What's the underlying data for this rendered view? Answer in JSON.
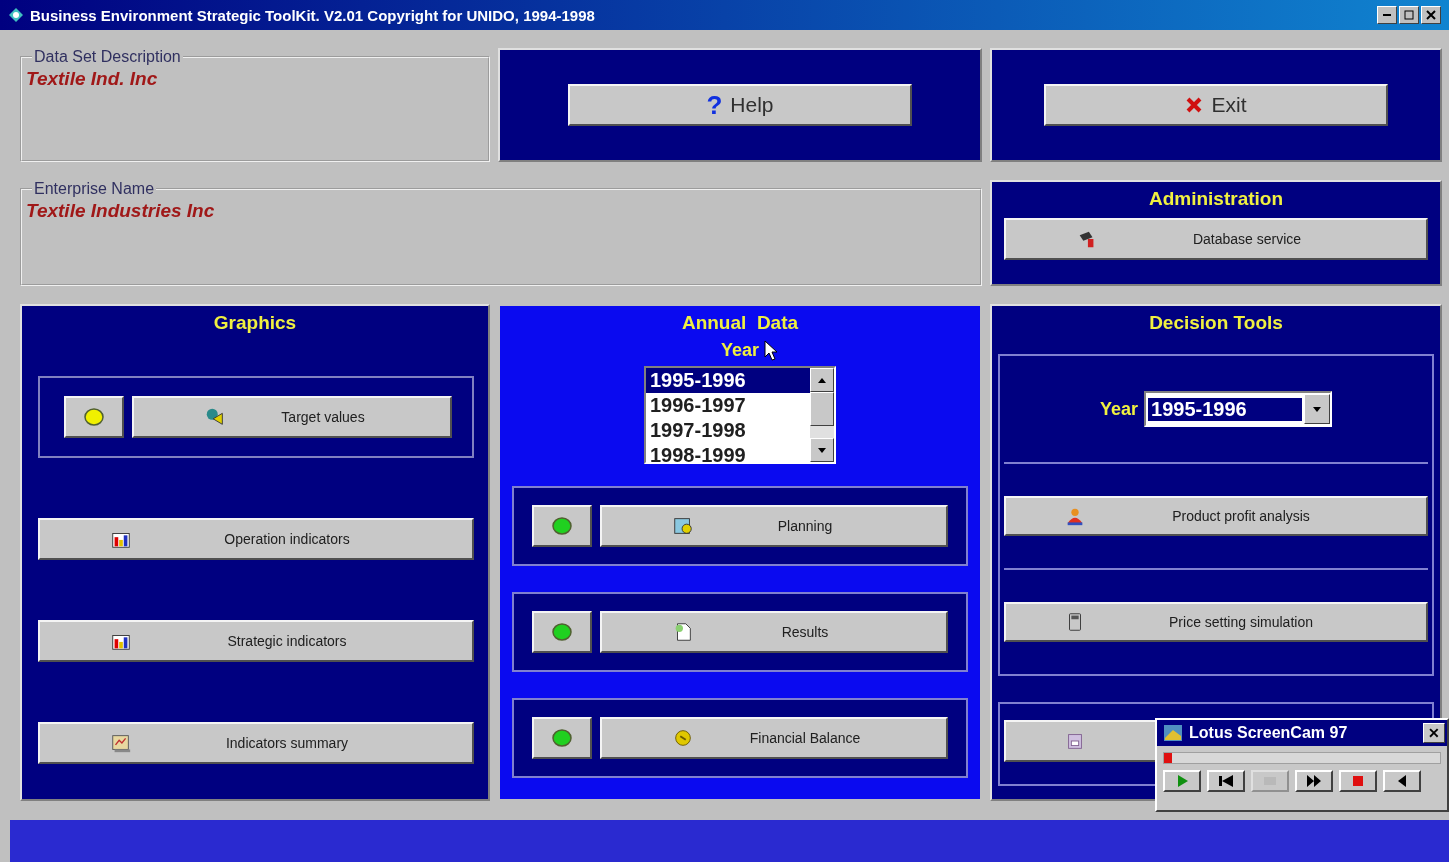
{
  "window": {
    "title": "Business Environment Strategic ToolKit. V2.01 Copyright for UNIDO, 1994-1998"
  },
  "data_set": {
    "legend": "Data Set Description",
    "value": "Textile Ind. Inc"
  },
  "help_button": {
    "icon_text": "?",
    "label": "Help"
  },
  "exit_button": {
    "label": "Exit"
  },
  "enterprise": {
    "legend": "Enterprise Name",
    "value": "Textile Industries Inc"
  },
  "administration": {
    "title": "Administration",
    "buttons": [
      {
        "label": "Database service"
      }
    ]
  },
  "graphics": {
    "title": "Graphics",
    "items": [
      {
        "kind": "lit",
        "label": "Target values",
        "color": "#f0f000"
      },
      {
        "kind": "plain",
        "label": "Operation indicators"
      },
      {
        "kind": "plain",
        "label": "Strategic indicators"
      },
      {
        "kind": "plain",
        "label": "Indicators summary"
      }
    ]
  },
  "annual_data": {
    "title": "Annual  Data",
    "year_label": "Year",
    "years": [
      {
        "label": "1995-1996",
        "selected": true
      },
      {
        "label": "1996-1997",
        "selected": false
      },
      {
        "label": "1997-1998",
        "selected": false
      },
      {
        "label": "1998-1999",
        "selected": false
      }
    ],
    "items": [
      {
        "label": "Planning",
        "color": "#20d020"
      },
      {
        "label": "Results",
        "color": "#20d020"
      },
      {
        "label": "Financial Balance",
        "color": "#20d020"
      }
    ]
  },
  "decision_tools": {
    "title": "Decision Tools",
    "year_label": "Year",
    "year_value": "1995-1996",
    "buttons": [
      {
        "label": "Product profit analysis"
      },
      {
        "label": "Price setting simulation"
      }
    ]
  },
  "screencam": {
    "title": "Lotus ScreenCam 97",
    "close_text": "✕",
    "level": 0.03,
    "controls": [
      {
        "kind": "play",
        "disabled": false
      },
      {
        "kind": "rewind",
        "disabled": false
      },
      {
        "kind": "blank",
        "disabled": true
      },
      {
        "kind": "forward",
        "disabled": false
      },
      {
        "kind": "record",
        "disabled": false
      },
      {
        "kind": "audio",
        "disabled": false
      }
    ]
  }
}
